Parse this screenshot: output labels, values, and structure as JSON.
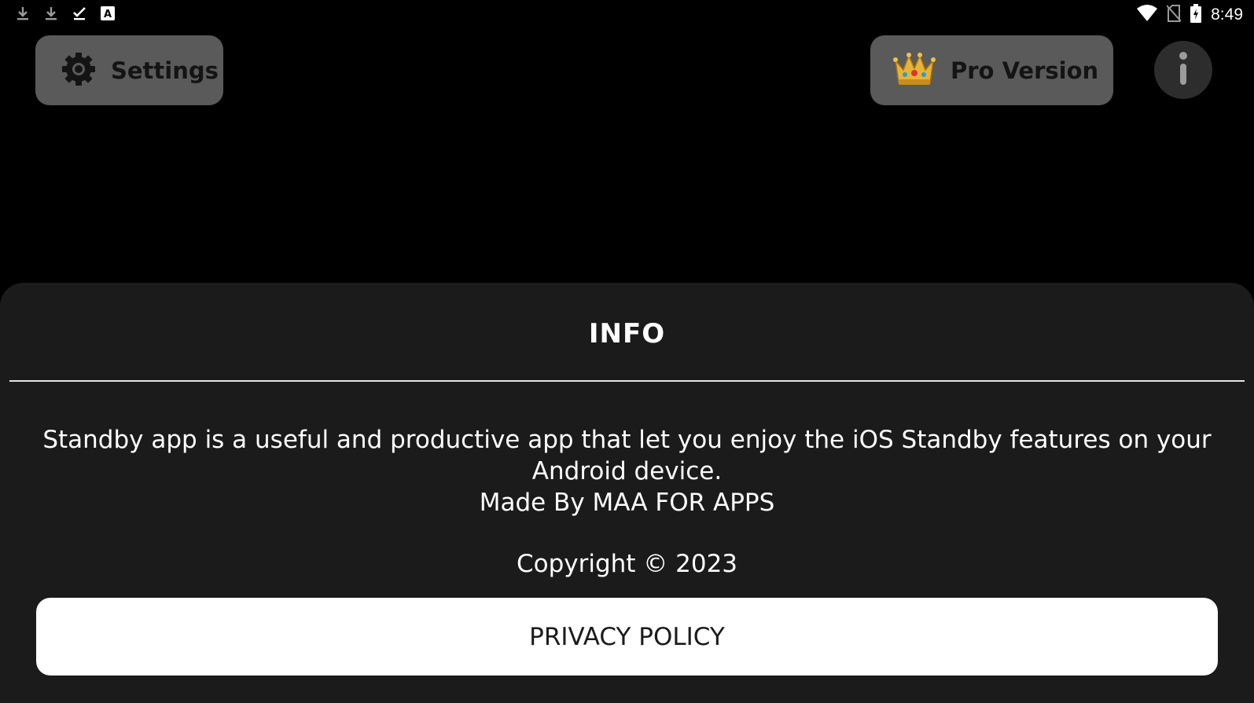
{
  "statusbar": {
    "time": "8:49",
    "left_icons": [
      "download-icon",
      "download-icon",
      "check-icon",
      "a-notification-icon"
    ],
    "right_icons": [
      "wifi-icon",
      "no-sim-icon",
      "battery-charging-icon"
    ]
  },
  "header": {
    "settings_label": "Settings",
    "pro_label": "Pro Version",
    "info_icon": "info-icon"
  },
  "sheet": {
    "title": "INFO",
    "description_line1": "Standby app is a useful and productive app that let you enjoy the iOS Standby features on your Android device.",
    "description_line2": "Made By MAA FOR APPS",
    "copyright": "Copyright © 2023",
    "privacy_label": "PRIVACY POLICY"
  },
  "colors": {
    "background": "#000000",
    "sheet_background": "#1b1b1c",
    "top_button": "#5a5a5a",
    "info_button": "#2d2d2d",
    "crown_gold": "#e8b437"
  }
}
